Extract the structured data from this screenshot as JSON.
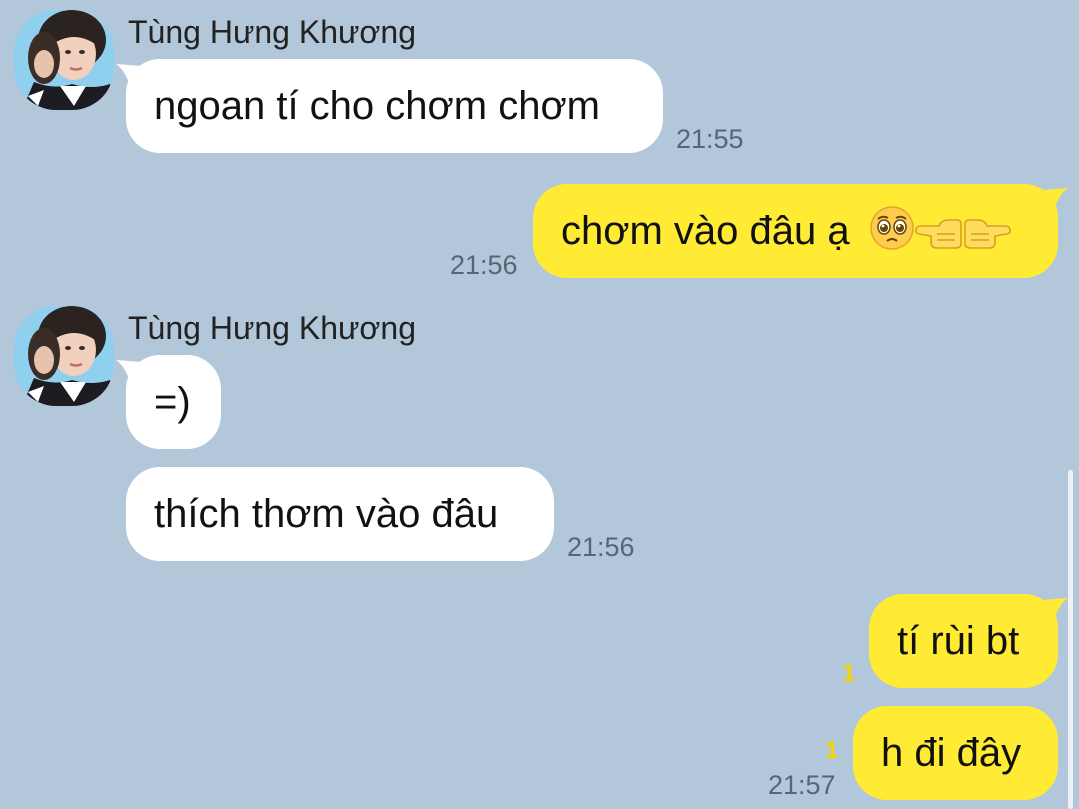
{
  "chat": {
    "partner_name": "Tùng Hưng Khương",
    "messages": [
      {
        "from": "partner",
        "text": "ngoan tí cho chơm chơm",
        "time": "21:55"
      },
      {
        "from": "me",
        "text": "chơm vào đâu ạ",
        "emojis": [
          "pleading-face",
          "backhand-index-left",
          "backhand-index-right"
        ],
        "time": "21:56"
      },
      {
        "from": "partner",
        "text": "=)"
      },
      {
        "from": "partner",
        "text": "thích thơm vào đâu",
        "time": "21:56"
      },
      {
        "from": "me",
        "text": "tí rùi bt",
        "unread": "1"
      },
      {
        "from": "me",
        "text": "h đi đây",
        "unread": "1",
        "time": "21:57"
      }
    ]
  },
  "colors": {
    "background": "#b2c7d9",
    "incoming_bubble": "#ffffff",
    "outgoing_bubble": "#ffeb33",
    "unread_counter": "#f5d400",
    "timestamp": "#556677"
  }
}
